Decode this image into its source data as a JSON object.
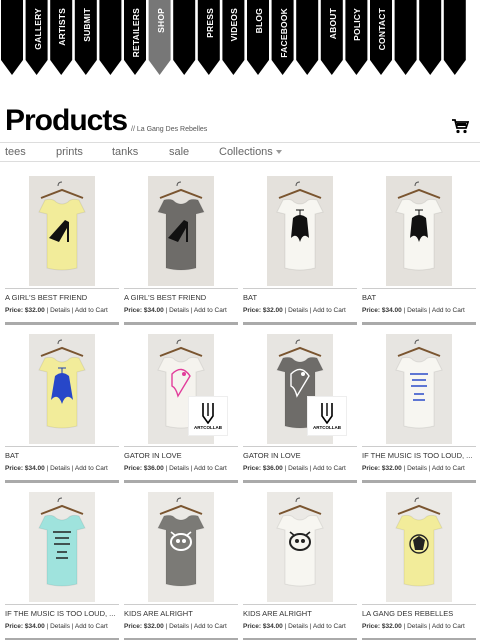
{
  "nav": {
    "items": [
      {
        "label": "GALLERY"
      },
      {
        "label": "ARTISTS"
      },
      {
        "label": "SUBMIT"
      },
      {
        "label": "RETAILERS"
      },
      {
        "label": "SHOP",
        "active": true
      },
      {
        "label": "PRESS"
      },
      {
        "label": "VIDEOS"
      },
      {
        "label": "BLOG"
      },
      {
        "label": "FACEBOOK"
      },
      {
        "label": "ABOUT"
      },
      {
        "label": "POLICY"
      },
      {
        "label": "CONTACT"
      }
    ],
    "colors": {
      "pennant": "#000000",
      "active": "#777777"
    }
  },
  "header": {
    "title": "Products",
    "breadcrumb": "// La Gang Des Rebelles",
    "cart_icon": "cart-icon"
  },
  "categories": {
    "tees": "tees",
    "prints": "prints",
    "tanks": "tanks",
    "sale": "sale",
    "collections": "Collections"
  },
  "products": [
    {
      "name": "A GIRL'S BEST FRIEND",
      "price": "Price: $32.00",
      "details": "Details",
      "add": "Add to Cart",
      "shirt_color": "#f2ec9a",
      "print": "shoe"
    },
    {
      "name": "A GIRL'S BEST FRIEND",
      "price": "Price: $34.00",
      "details": "Details",
      "add": "Add to Cart",
      "shirt_color": "#6e6c69",
      "print": "shoe"
    },
    {
      "name": "BAT",
      "price": "Price: $32.00",
      "details": "Details",
      "add": "Add to Cart",
      "shirt_color": "#f7f6f1",
      "print": "bat-black"
    },
    {
      "name": "BAT",
      "price": "Price: $34.00",
      "details": "Details",
      "add": "Add to Cart",
      "shirt_color": "#f7f6f1",
      "print": "bat-black"
    },
    {
      "name": "BAT",
      "price": "Price: $34.00",
      "details": "Details",
      "add": "Add to Cart",
      "shirt_color": "#f2ec9a",
      "print": "bat-blue"
    },
    {
      "name": "GATOR IN LOVE",
      "price": "Price: $36.00",
      "details": "Details",
      "add": "Add to Cart",
      "shirt_color": "#f5f3ee",
      "print": "gator-pink",
      "badge": "ARTCOLLAB"
    },
    {
      "name": "GATOR IN LOVE",
      "price": "Price: $36.00",
      "details": "Details",
      "add": "Add to Cart",
      "shirt_color": "#6e6c69",
      "print": "gator-white",
      "badge": "ARTCOLLAB"
    },
    {
      "name": "IF THE MUSIC IS TOO LOUD, ...",
      "price": "Price: $32.00",
      "details": "Details",
      "add": "Add to Cart",
      "shirt_color": "#f7f6f1",
      "print": "music-blue"
    },
    {
      "name": "IF THE MUSIC IS TOO LOUD, ...",
      "price": "Price: $34.00",
      "details": "Details",
      "add": "Add to Cart",
      "shirt_color": "#9fe3dd",
      "print": "music-black"
    },
    {
      "name": "KIDS ARE ALRIGHT",
      "price": "Price: $32.00",
      "details": "Details",
      "add": "Add to Cart",
      "shirt_color": "#7b7a76",
      "print": "kids"
    },
    {
      "name": "KIDS ARE ALRIGHT",
      "price": "Price: $34.00",
      "details": "Details",
      "add": "Add to Cart",
      "shirt_color": "#f7f6f1",
      "print": "kids"
    },
    {
      "name": "LA GANG DES REBELLES",
      "price": "Price: $32.00",
      "details": "Details",
      "add": "Add to Cart",
      "shirt_color": "#f2ec9a",
      "print": "crest"
    }
  ]
}
